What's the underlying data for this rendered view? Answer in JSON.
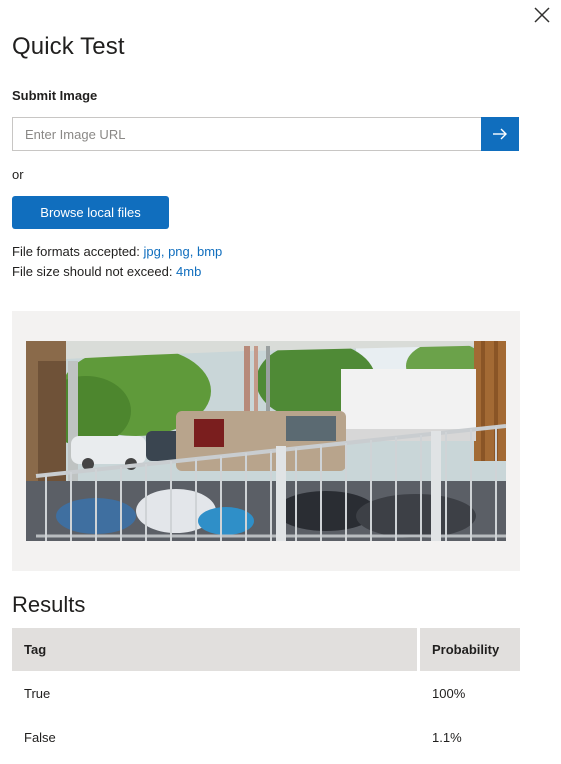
{
  "panel": {
    "title": "Quick Test",
    "close_icon": "close-icon"
  },
  "submit": {
    "label": "Submit Image",
    "url_placeholder": "Enter Image URL",
    "url_value": "",
    "go_icon": "arrow-right-icon",
    "or_text": "or",
    "browse_label": "Browse local files"
  },
  "info": {
    "formats_prefix": "File formats accepted: ",
    "formats_value": "jpg, png, bmp",
    "size_prefix": "File size should not exceed: ",
    "size_value": "4mb"
  },
  "results": {
    "title": "Results",
    "columns": [
      "Tag",
      "Probability"
    ],
    "rows": [
      {
        "tag": "True",
        "probability": "100%"
      },
      {
        "tag": "False",
        "probability": "1.1%"
      }
    ]
  },
  "colors": {
    "accent": "#106ebe",
    "panel_bg": "#f3f2f1",
    "header_bg": "#e1dfdd"
  }
}
